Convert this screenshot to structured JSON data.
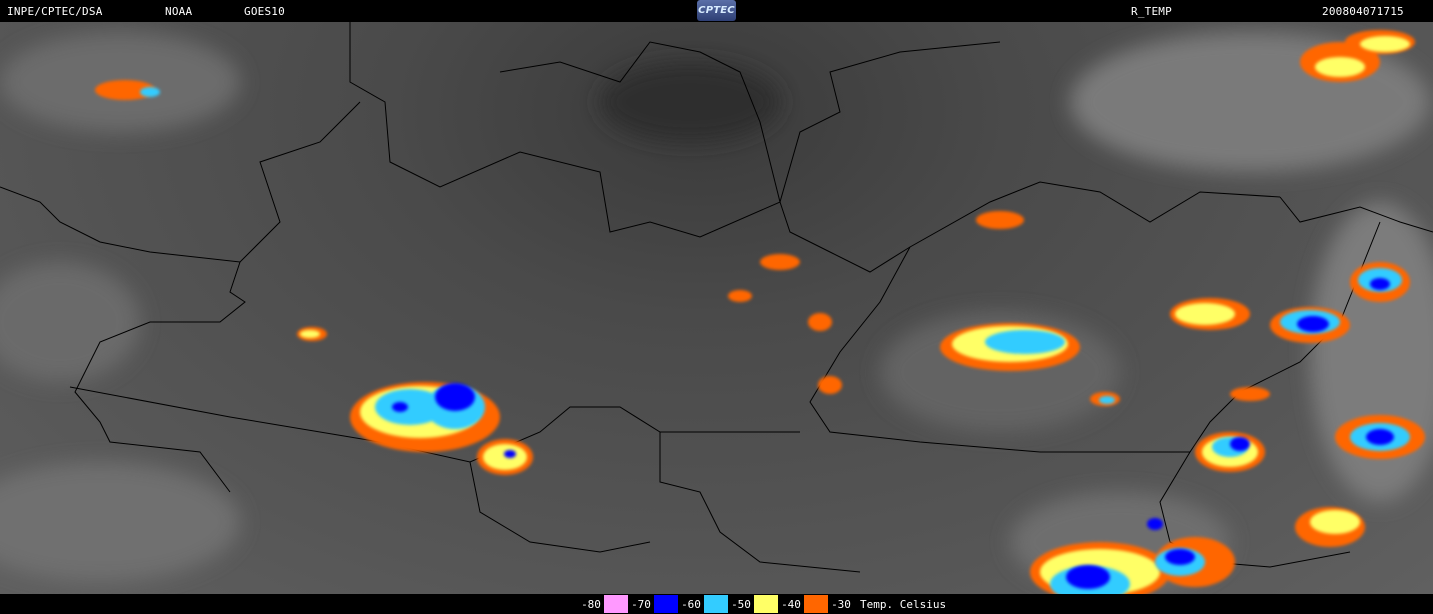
{
  "header": {
    "source": "INPE/CPTEC/DSA",
    "agency": "NOAA",
    "satellite": "GOES10",
    "logo_text": "CPTEC",
    "product": "R_TEMP",
    "datetime": "200804071715"
  },
  "legend": {
    "items": [
      {
        "label": "-80",
        "color": "#ff99ff"
      },
      {
        "label": "-70",
        "color": "#0000ff"
      },
      {
        "label": "-60",
        "color": "#33ccff"
      },
      {
        "label": "-50",
        "color": "#ffff66"
      },
      {
        "label": "-40",
        "color": "#ff6600"
      },
      {
        "label": "-30",
        "color": ""
      }
    ],
    "unit": "Temp. Celsius"
  },
  "colors": {
    "background": "#000000",
    "cloud_gray": "#8a8a8a",
    "border_line": "#000000"
  }
}
